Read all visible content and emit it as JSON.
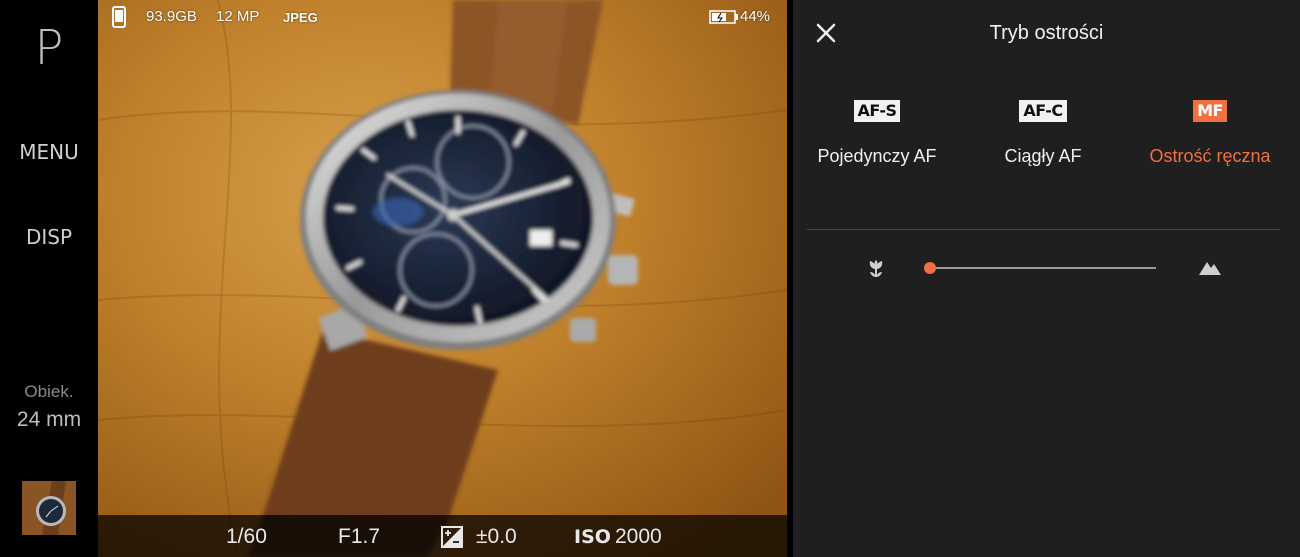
{
  "left_rail": {
    "mode": "P",
    "menu_label": "MENU",
    "disp_label": "DISP",
    "lens_label": "Obiek.",
    "lens_value": "24 mm"
  },
  "viewfinder": {
    "status": {
      "storage": "93.9GB",
      "megapixels": "12 MP",
      "format": "JPEG",
      "battery": "44%"
    },
    "settings": {
      "shutter": "1/60",
      "aperture": "F1.7",
      "exposure_comp": "±0.0",
      "iso_label": "ISO",
      "iso_value": "2000"
    }
  },
  "focus_panel": {
    "title": "Tryb ostrości",
    "modes": [
      {
        "badge": "AF-S",
        "label": "Pojedynczy AF",
        "selected": false
      },
      {
        "badge": "AF-C",
        "label": "Ciągły AF",
        "selected": false
      },
      {
        "badge": "MF",
        "label": "Ostrość ręczna",
        "selected": true
      }
    ],
    "focus_slider_position": 0.0
  },
  "colors": {
    "accent": "#f0703f",
    "panel_bg": "#1f1f1f"
  },
  "icons": [
    "storage-icon",
    "battery-icon",
    "exposure-comp-icon",
    "close-icon",
    "macro-flower-icon",
    "landscape-mountain-icon"
  ]
}
